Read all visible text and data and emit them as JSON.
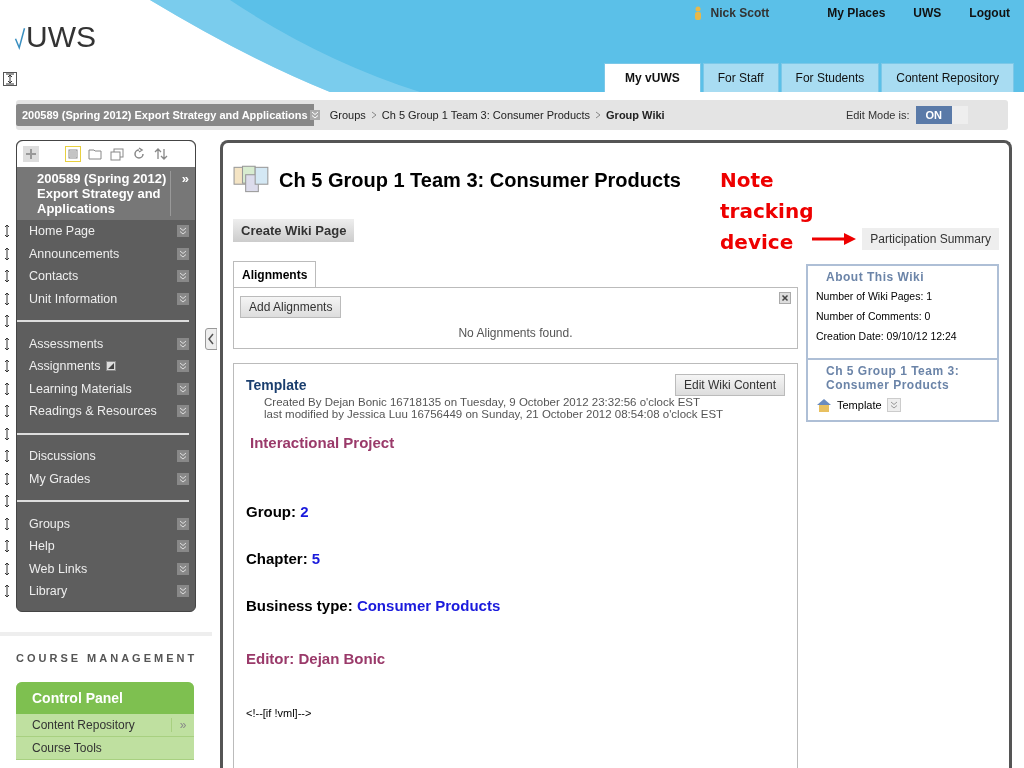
{
  "header": {
    "logo": "UWS",
    "user": "Nick Scott",
    "links": [
      "My Places",
      "UWS",
      "Logout"
    ],
    "tabs": [
      {
        "label": "My vUWS",
        "selected": true
      },
      {
        "label": "For Staff",
        "selected": false
      },
      {
        "label": "For Students",
        "selected": false
      },
      {
        "label": "Content Repository",
        "selected": false
      }
    ]
  },
  "breadcrumb": {
    "course": "200589 (Spring 2012) Export Strategy and Applications",
    "path": [
      "Groups",
      "Ch 5 Group 1 Team 3: Consumer Products"
    ],
    "current": "Group Wiki",
    "edit_mode_label": "Edit Mode is:",
    "edit_mode_on": true,
    "edit_mode_text": "ON"
  },
  "course_menu": {
    "title": "200589 (Spring 2012) Export Strategy and Applications",
    "collapse": "»",
    "items": [
      {
        "kind": "link",
        "label": "Home Page",
        "badge": false
      },
      {
        "kind": "link",
        "label": "Announcements",
        "badge": false
      },
      {
        "kind": "link",
        "label": "Contacts",
        "badge": false
      },
      {
        "kind": "link",
        "label": "Unit Information",
        "badge": false
      },
      {
        "kind": "divider"
      },
      {
        "kind": "link",
        "label": "Assessments",
        "badge": false
      },
      {
        "kind": "link",
        "label": "Assignments",
        "badge": true
      },
      {
        "kind": "link",
        "label": "Learning Materials",
        "badge": false
      },
      {
        "kind": "link",
        "label": "Readings & Resources",
        "badge": false
      },
      {
        "kind": "divider"
      },
      {
        "kind": "link",
        "label": "Discussions",
        "badge": false
      },
      {
        "kind": "link",
        "label": "My Grades",
        "badge": false
      },
      {
        "kind": "divider"
      },
      {
        "kind": "link",
        "label": "Groups",
        "badge": false
      },
      {
        "kind": "link",
        "label": "Help",
        "badge": false
      },
      {
        "kind": "link",
        "label": "Web Links",
        "badge": false
      },
      {
        "kind": "link",
        "label": "Library",
        "badge": false
      }
    ]
  },
  "course_management": {
    "heading": "COURSE MANAGEMENT",
    "panel_title": "Control Panel",
    "items": [
      {
        "label": "Content Repository",
        "more": "»"
      },
      {
        "label": "Course Tools"
      }
    ]
  },
  "wiki": {
    "title": "Ch 5 Group 1 Team 3: Consumer Products",
    "create_button": "Create Wiki Page",
    "participation_button": "Participation Summary",
    "annotation": "Note tracking device",
    "alignments": {
      "tab": "Alignments",
      "add_button": "Add Alignments",
      "empty": "No Alignments found."
    },
    "page": {
      "title": "Template",
      "edit_button": "Edit Wiki Content",
      "created": "Created By Dejan Bonic 16718135 on Tuesday, 9 October 2012 23:32:56 o'clock EST",
      "modified": "last modified by Jessica Luu 16756449 on Sunday, 21 October 2012 08:54:08 o'clock EST",
      "heading": "Interactional Project",
      "fields": [
        {
          "label": "Group:",
          "value": "2"
        },
        {
          "label": "Chapter:",
          "value": "5"
        },
        {
          "label": "Business type:",
          "value": "Consumer Products"
        }
      ],
      "editor": "Editor:  Dejan Bonic",
      "code_line": "<!--[if !vml]-->"
    },
    "about": {
      "title": "About This Wiki",
      "lines": [
        "Number of Wiki Pages: 1",
        "Number of Comments: 0",
        "Creation Date: 09/10/12 12:24"
      ]
    },
    "pages_box": {
      "title": "Ch 5 Group 1 Team 3: Consumer Products",
      "pages": [
        "Template"
      ]
    }
  }
}
